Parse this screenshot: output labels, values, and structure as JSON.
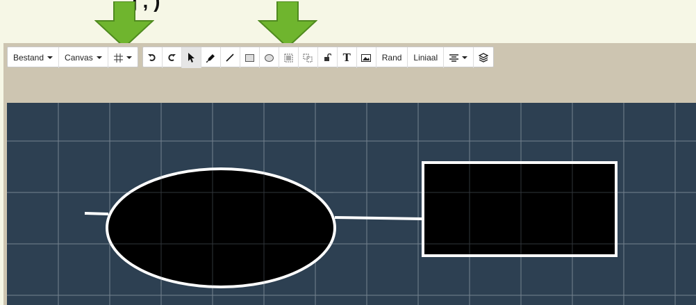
{
  "header_text": "j  , )",
  "toolbar": {
    "bestand": "Bestand",
    "canvas": "Canvas",
    "rand": "Rand",
    "liniaal": "Liniaal",
    "text_tool_glyph": "T"
  },
  "colors": {
    "page_bg": "#f6f7e6",
    "app_bg": "#cdc5b1",
    "canvas_bg": "#2d4052",
    "grid": "#8e9aa5",
    "arrow_green": "#6fb52e",
    "shape_fill": "#000000",
    "shape_stroke": "#ffffff"
  },
  "icons": [
    "grid-icon",
    "undo-icon",
    "redo-icon",
    "select-arrow-icon",
    "pen-icon",
    "line-icon",
    "rectangle-icon",
    "ellipse-icon",
    "group-icon",
    "ungroup-icon",
    "lock-icon",
    "text-icon",
    "image-icon",
    "align-icon",
    "layers-icon"
  ]
}
